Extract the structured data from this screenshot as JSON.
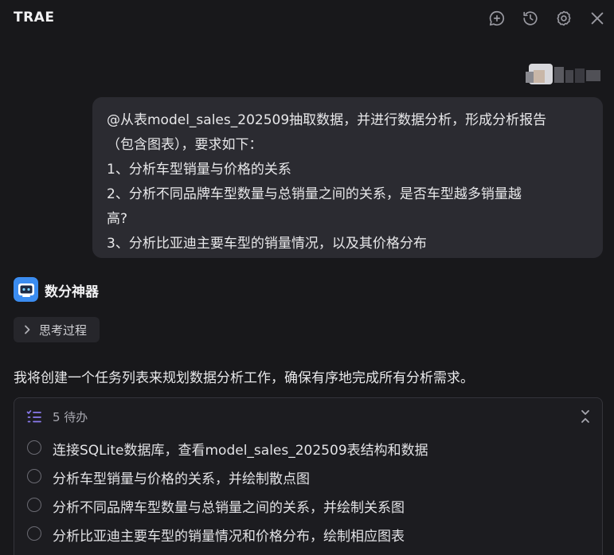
{
  "header": {
    "title": "TRAE",
    "icons": [
      "new-chat-icon",
      "history-icon",
      "settings-icon",
      "close-icon"
    ]
  },
  "user_message": {
    "lines": [
      "@从表model_sales_202509抽取数据，并进行数据分析，形成分析报告",
      "（包含图表），要求如下：",
      "1、分析车型销量与价格的关系",
      "2、分析不同品牌车型数量与总销量之间的关系，是否车型越多销量越",
      "高?",
      "3、分析比亚迪主要车型的销量情况，以及其价格分布"
    ]
  },
  "assistant": {
    "name": "数分神器",
    "thinking_label": "思考过程",
    "text": "我将创建一个任务列表来规划数据分析工作，确保有序地完成所有分析需求。"
  },
  "todo": {
    "count_label": "5 待办",
    "items": [
      "连接SQLite数据库，查看model_sales_202509表结构和数据",
      "分析车型销量与价格的关系，并绘制散点图",
      "分析不同品牌车型数量与总销量之间的关系，并绘制关系图",
      "分析比亚迪主要车型的销量情况和价格分布，绘制相应图表"
    ]
  },
  "colors": {
    "background": "#18181b",
    "bubble": "#2b2b31",
    "accent": "#3b8cf0"
  }
}
